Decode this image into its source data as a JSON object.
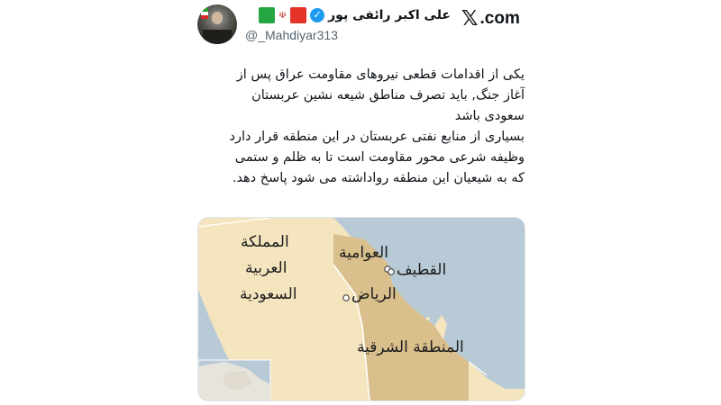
{
  "brand": {
    "logo_letter": "𝕏",
    "logo_suffix": ".com"
  },
  "account": {
    "name": "علی اکبر رائفی پور",
    "handle": "@_Mahdiyar313",
    "verified_icon": "verified-check-icon",
    "flag_colors": {
      "red": "#e5332a",
      "green": "#25a641"
    }
  },
  "tweet": {
    "line1": "یکی از اقدامات قطعی نیروهای مقاومت عراق پس از",
    "line2": "آغاز جنگ, باید تصرف مناطق شیعه نشین عربستان",
    "line3": "سعودی باشد",
    "line4": "بسیاری از منابع نفتی عربستان در این منطقه قرار دارد",
    "line5": "وظیفه شرعی محور مقاومت است تا  به ظلم و ستمی",
    "line6": "که به شیعیان این منطقه رواداشته می شود پاسخ دهد."
  },
  "map": {
    "country_line1": "المملكة",
    "country_line2": "العربية",
    "country_line3": "السعودية",
    "city_awamiyah": "العوامية",
    "city_qatif": "القطيف",
    "city_riyadh": "الرياض",
    "region_eastern": "المنطقة الشرقية",
    "colors": {
      "sea": "#b8cad6",
      "land": "#f5e5bf",
      "region": "#d9bf8c",
      "border": "#ffffff"
    }
  }
}
